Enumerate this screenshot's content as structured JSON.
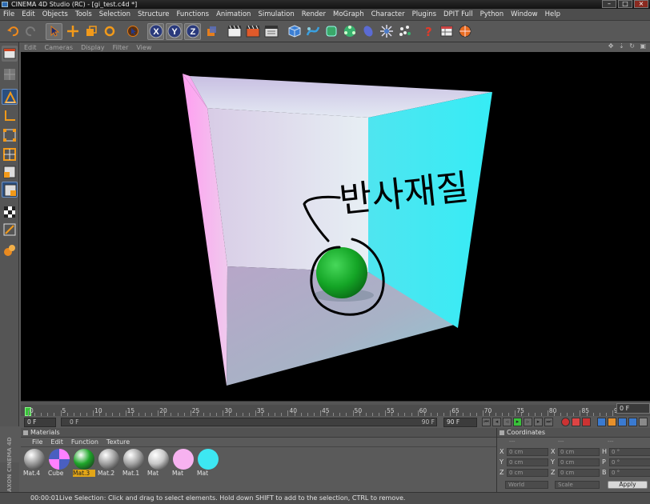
{
  "title": "CINEMA 4D Studio (RC) - [gi_test.c4d *]",
  "menus": [
    "File",
    "Edit",
    "Objects",
    "Tools",
    "Selection",
    "Structure",
    "Functions",
    "Animation",
    "Simulation",
    "Render",
    "MoGraph",
    "Character",
    "Plugins",
    "DPIT Full",
    "Python",
    "Window",
    "Help"
  ],
  "toolbar_axes": [
    "X",
    "Y",
    "Z"
  ],
  "viewport_menu": [
    "Edit",
    "Cameras",
    "Display",
    "Filter",
    "View"
  ],
  "viewport_annotation": "반사재질",
  "timeline": {
    "ticks": [
      "0",
      "5",
      "10",
      "15",
      "20",
      "25",
      "30",
      "35",
      "40",
      "45",
      "50",
      "55",
      "60",
      "65",
      "70",
      "75",
      "80",
      "85",
      "90"
    ],
    "end_frame": "0 F",
    "current_frame": "0 F",
    "slider_start": "0 F",
    "slider_end": "90 F",
    "max_frame": "90 F"
  },
  "materials": {
    "header": "Materials",
    "menu": [
      "File",
      "Edit",
      "Function",
      "Texture"
    ],
    "items": [
      {
        "label": "Mat.4",
        "color": "#9a9a9a",
        "type": "sphere"
      },
      {
        "label": "Cube",
        "color": "#ff80ff",
        "type": "cube"
      },
      {
        "label": "Mat.3",
        "color": "#1fa62a",
        "type": "sphere",
        "selected": true
      },
      {
        "label": "Mat.2",
        "color": "#a0a0a0",
        "type": "sphere"
      },
      {
        "label": "Mat.1",
        "color": "#a4a4a4",
        "type": "sphere"
      },
      {
        "label": "Mat",
        "color": "#c8c8c8",
        "type": "sphere"
      },
      {
        "label": "Mat",
        "color": "#f7b2f0",
        "type": "flat"
      },
      {
        "label": "Mat",
        "color": "#3de7f2",
        "type": "flat"
      }
    ]
  },
  "coordinates": {
    "header": "Coordinates",
    "col_headers": [
      "---",
      "---",
      "---"
    ],
    "rows": [
      [
        {
          "axis": "X",
          "value": "0 cm"
        },
        {
          "axis": "X",
          "value": "0 cm"
        },
        {
          "axis": "H",
          "value": "0 °"
        }
      ],
      [
        {
          "axis": "Y",
          "value": "0 cm"
        },
        {
          "axis": "Y",
          "value": "0 cm"
        },
        {
          "axis": "P",
          "value": "0 °"
        }
      ],
      [
        {
          "axis": "Z",
          "value": "0 cm"
        },
        {
          "axis": "Z",
          "value": "0 cm"
        },
        {
          "axis": "B",
          "value": "0 °"
        }
      ]
    ],
    "mode": "World",
    "mode2": "Scale",
    "apply": "Apply"
  },
  "brand": "MAXON CINEMA 4D",
  "status": {
    "time": "00:00:01",
    "message": "Live Selection: Click and drag to select elements. Hold down SHIFT to add to the selection, CTRL to remove."
  }
}
